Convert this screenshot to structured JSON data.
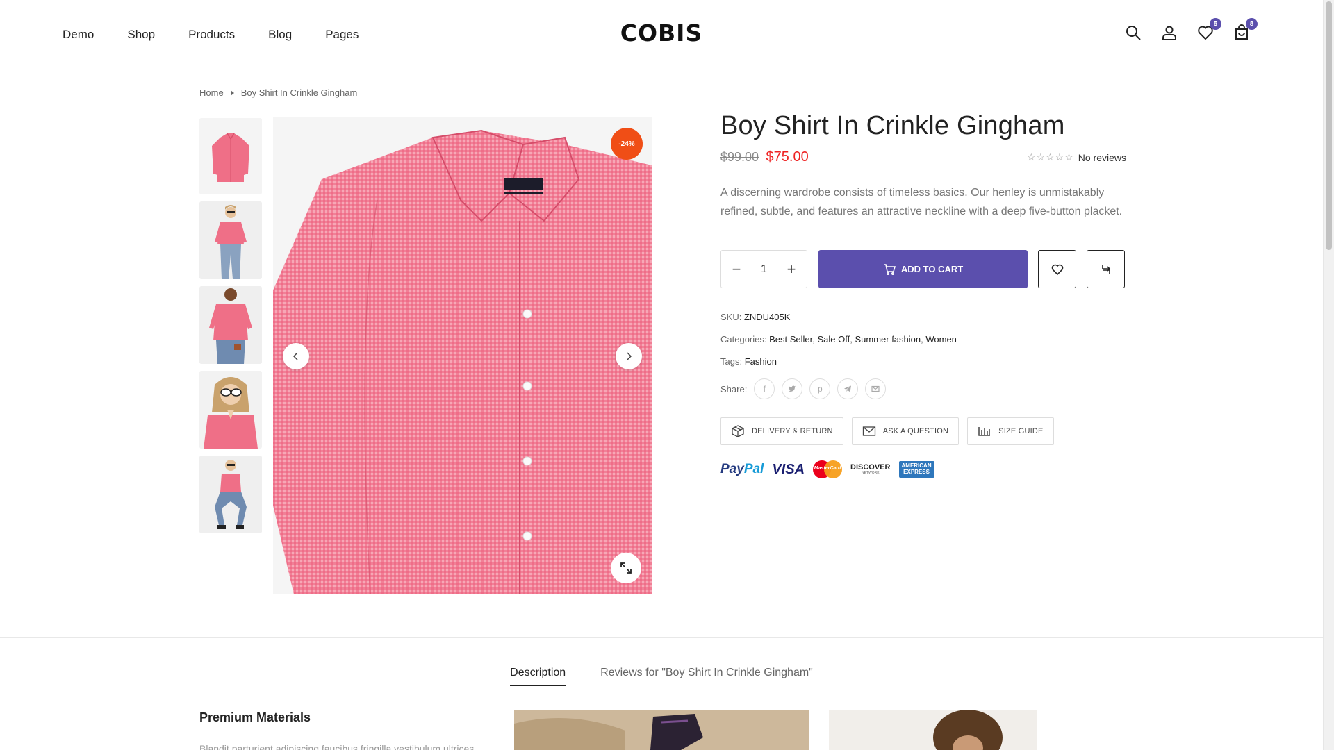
{
  "header": {
    "nav": [
      "Demo",
      "Shop",
      "Products",
      "Blog",
      "Pages"
    ],
    "logo": "COBIS",
    "icons": [
      "search-icon",
      "user-icon",
      "heart-icon",
      "cart-icon"
    ],
    "wishlist_count": "5",
    "cart_count": "8"
  },
  "breadcrumb": {
    "home": "Home",
    "current": "Boy Shirt In Crinkle Gingham"
  },
  "gallery": {
    "sale_badge": "-24%",
    "thumbnail_count": 5
  },
  "product": {
    "title": "Boy Shirt In Crinkle Gingham",
    "price_old": "$99.00",
    "price_new": "$75.00",
    "stars": "☆☆☆☆☆",
    "reviews": "No reviews",
    "description": "A discerning wardrobe consists of timeless basics. Our henley is unmistakably refined, subtle, and features an attractive neckline with a deep five-button placket.",
    "quantity": "1",
    "add_to_cart": "ADD TO CART",
    "sku_label": "SKU:",
    "sku": "ZNDU405K",
    "categories_label": "Categories:",
    "categories": [
      "Best Seller",
      "Sale Off",
      "Summer fashion",
      "Women"
    ],
    "tags_label": "Tags:",
    "tags": "Fashion",
    "share_label": "Share:",
    "share_icons": [
      "facebook-icon",
      "twitter-icon",
      "pinterest-icon",
      "telegram-icon",
      "email-icon"
    ],
    "delivery_return": "DELIVERY & RETURN",
    "ask_question": "ASK A QUESTION",
    "size_guide": "SIZE GUIDE"
  },
  "payments": {
    "paypal_a": "Pay",
    "paypal_b": "Pal",
    "visa": "VISA",
    "mastercard": "MasterCard",
    "discover": "DISCOVER",
    "discover_sub": "NETWORK",
    "amex_a": "AMERICAN",
    "amex_b": "EXPRESS"
  },
  "tabs": {
    "description": "Description",
    "reviews": "Reviews for \"Boy Shirt In Crinkle Gingham\""
  },
  "section": {
    "title": "Premium Materials",
    "text": "Blandit parturient adipiscing faucibus fringilla vestibulum ultrices"
  },
  "colors": {
    "accent": "#5b4fad",
    "sale": "#f04e16",
    "price": "#ee2222",
    "shirt": "#ef6f87"
  }
}
